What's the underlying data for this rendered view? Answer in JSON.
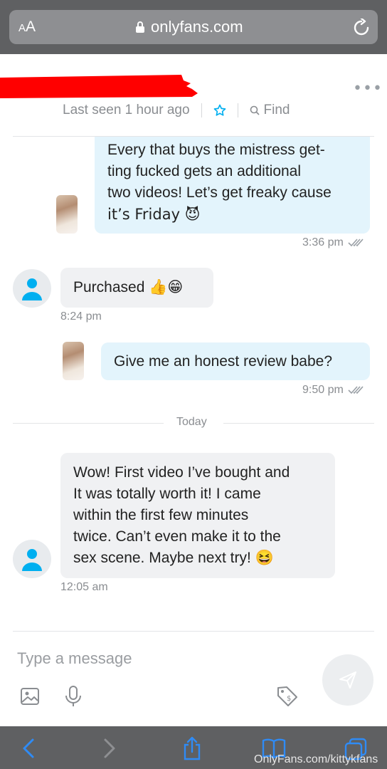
{
  "browser": {
    "text_size_label_small": "A",
    "text_size_label_large": "A",
    "url": "onlyfans.com"
  },
  "chat_header": {
    "last_seen": "Last seen 1 hour ago",
    "find_label": "Find",
    "more_label": "•••"
  },
  "messages": [
    {
      "direction": "outgoing",
      "lines": [
        "Every that buys the mistress get-",
        "ting fucked gets an additional",
        "two videos! Let’s get freaky cause",
        "it’s Friday 😈"
      ],
      "time": "3:36 pm"
    },
    {
      "direction": "incoming",
      "lines": [
        "Purchased 👍😁"
      ],
      "time": "8:24 pm"
    },
    {
      "direction": "outgoing",
      "lines": [
        "Give me an honest review babe?"
      ],
      "time": "9:50 pm"
    },
    {
      "direction": "incoming",
      "lines": [
        "Wow! First video I’ve bought and",
        "It was totally worth it! I came",
        "within the first few minutes",
        "twice. Can’t even make it to the",
        "sex scene. Maybe next try! 😆"
      ],
      "time": "12:05 am"
    }
  ],
  "divider": {
    "label": "Today"
  },
  "composer": {
    "placeholder": "Type a message"
  },
  "watermark": "OnlyFans.com/kittykfans",
  "colors": {
    "outgoing_bubble": "#e3f4fc",
    "incoming_bubble": "#f0f1f3",
    "accent": "#00aff0",
    "browser_chrome": "#5f6062",
    "redaction": "#ff0000"
  }
}
